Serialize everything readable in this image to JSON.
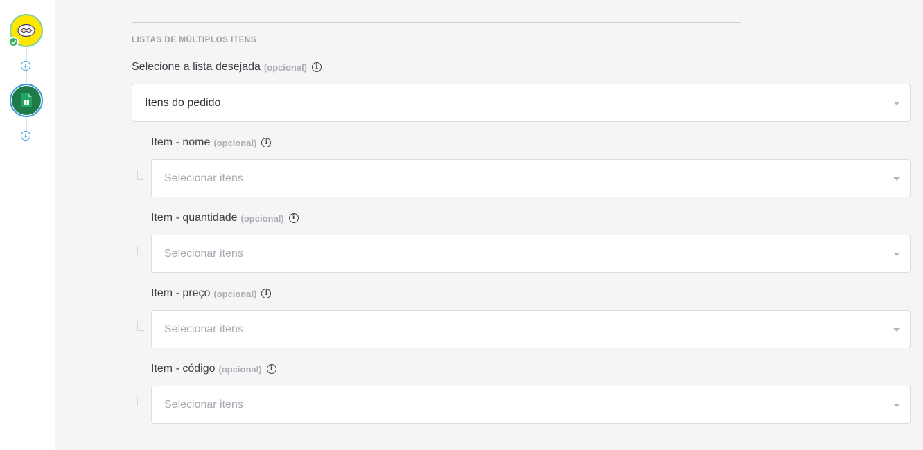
{
  "flow": {
    "steps": [
      {
        "icon": "handshake-icon",
        "status": "check-icon",
        "color": "#ffe600"
      },
      {
        "icon": "spreadsheet-icon",
        "color": "#1e7b47"
      }
    ],
    "add_symbol": "+"
  },
  "section": {
    "title": "LISTAS DE MÚLTIPLOS ITENS",
    "list_select": {
      "label": "Selecione a lista desejada",
      "optional": "(opcional)",
      "value": "Itens do pedido"
    },
    "fields": [
      {
        "label": "Item - nome",
        "optional": "(opcional)",
        "placeholder": "Selecionar itens"
      },
      {
        "label": "Item - quantidade",
        "optional": "(opcional)",
        "placeholder": "Selecionar itens"
      },
      {
        "label": "Item - preço",
        "optional": "(opcional)",
        "placeholder": "Selecionar itens"
      },
      {
        "label": "Item - código",
        "optional": "(opcional)",
        "placeholder": "Selecionar itens"
      }
    ]
  },
  "info_symbol": "i",
  "colors": {
    "accent": "#4aa3e0",
    "success": "#33b864"
  }
}
